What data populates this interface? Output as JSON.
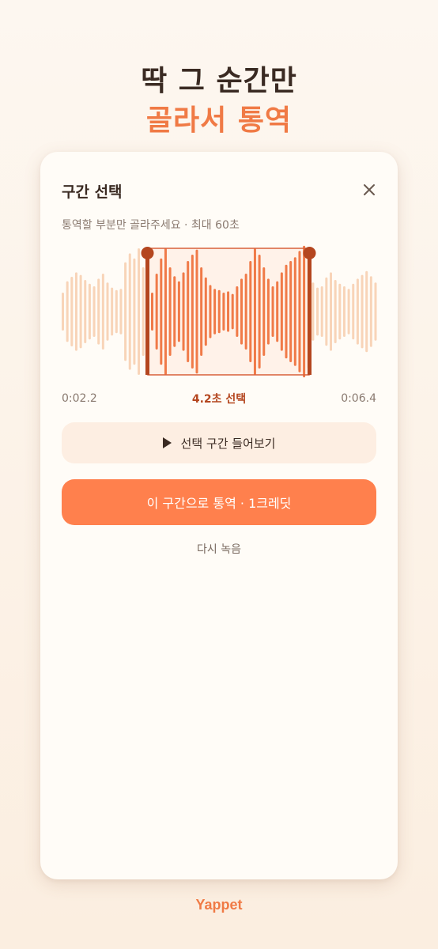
{
  "headline": {
    "line1": "딱 그 순간만",
    "line2": "골라서 통역"
  },
  "dialog": {
    "title": "구간 선택",
    "subtitle": "통역할 부분만 골라주세요 · 최대 60초",
    "close_icon": "close-icon"
  },
  "selection": {
    "start_time": "0:02.2",
    "end_time": "0:06.4",
    "selected_label": "4.2초 선택"
  },
  "buttons": {
    "preview_label": "선택 구간 들어보기",
    "translate_label": "이 구간으로 통역 · 1크레딧",
    "retry_label": "다시 녹음"
  },
  "brand": "Yappet",
  "colors": {
    "accent": "#ff804d",
    "accent_dark": "#b4461f",
    "bar_inactive": "#f8d4b8",
    "bar_active": "#ef7a48",
    "text_dark": "#3a2a22"
  }
}
